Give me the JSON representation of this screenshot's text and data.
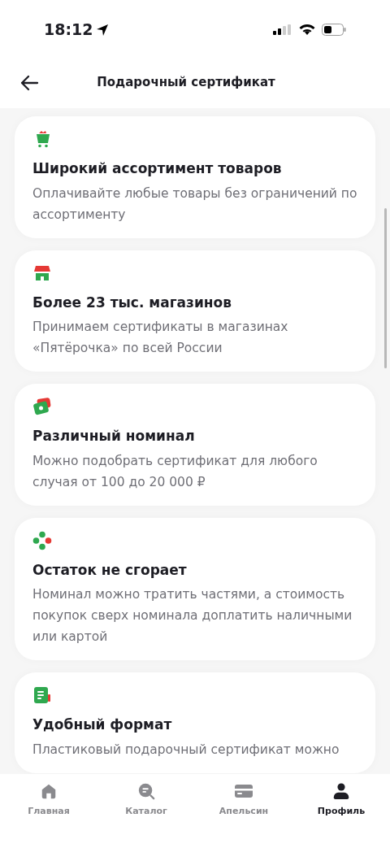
{
  "status_bar": {
    "time": "18:12"
  },
  "header": {
    "title": "Подарочный сертификат"
  },
  "cards": [
    {
      "title": "Широкий ассортимент товаров",
      "description": "Оплачивайте любые товары без ограничений по ассортименту"
    },
    {
      "title": "Более 23 тыс. магазинов",
      "description": "Принимаем сертификаты в магазинах «Пятёрочка» по всей России"
    },
    {
      "title": "Различный номинал",
      "description": "Можно подобрать сертификат для любого случая от 100 до 20 000 ₽"
    },
    {
      "title": "Остаток не сгорает",
      "description": "Номинал можно тратить частями, а стоимость покупок сверх номинала доплатить наличными или картой"
    },
    {
      "title": "Удобный формат",
      "description": "Пластиковый подарочный сертификат можно"
    }
  ],
  "tab_bar": [
    {
      "label": "Главная",
      "selected": false
    },
    {
      "label": "Каталог",
      "selected": false
    },
    {
      "label": "Апельсин",
      "selected": false
    },
    {
      "label": "Профиль",
      "selected": true
    }
  ]
}
